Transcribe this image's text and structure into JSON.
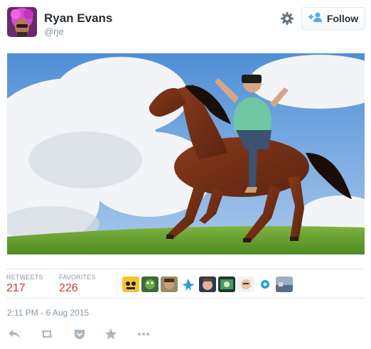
{
  "user": {
    "name": "Ryan Evans",
    "handle": "@rje"
  },
  "follow_button": {
    "label": "Follow"
  },
  "stats": {
    "retweets_label": "RETWEETS",
    "retweets_value": "217",
    "favorites_label": "FAVORITES",
    "favorites_value": "226"
  },
  "timestamp": "2:11 PM - 6 Aug 2015",
  "colors": {
    "accent": "#55acee",
    "stat_value": "#cc3a2e",
    "muted": "#8899a6",
    "border": "#e1e8ed"
  },
  "icons": {
    "settings": "gear-icon",
    "follow": "add-user-icon",
    "reply": "reply-icon",
    "retweet": "retweet-icon",
    "pocket": "pocket-icon",
    "favorite": "star-icon",
    "more": "more-icon"
  }
}
